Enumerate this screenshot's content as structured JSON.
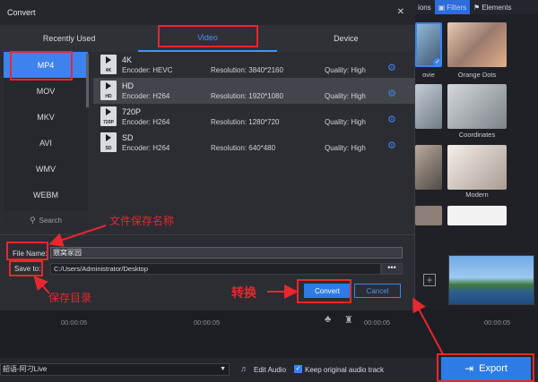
{
  "app": {
    "topbar": {
      "options_label": "ions",
      "filters_label": "Filters",
      "elements_label": "Elements"
    },
    "filters": [
      {
        "label": "ovie"
      },
      {
        "label": "Orange Dots"
      },
      {
        "label": "Coordinates"
      },
      {
        "label": "Modern"
      }
    ],
    "timeline": {
      "time_left": "00:00:05",
      "time_mid": "00:00:05",
      "time_right1": "00:00:05",
      "time_right2": "00:00:05"
    },
    "bottom": {
      "audio_track": "韶语-阿刁Live",
      "edit_audio": "Edit Audio",
      "keep_audio": "Keep original audio track",
      "export_label": "Export"
    }
  },
  "dialog": {
    "title": "Convert",
    "close_glyph": "✕",
    "tabs": [
      {
        "label": "Recently Used"
      },
      {
        "label": "Video"
      },
      {
        "label": "Device"
      }
    ],
    "formats": [
      "MP4",
      "MOV",
      "MKV",
      "AVI",
      "WMV",
      "WEBM"
    ],
    "search_label": "Search",
    "qualities": [
      {
        "icon": "4K",
        "name": "4K",
        "encoder": "Encoder: HEVC",
        "resolution": "Resolution: 3840*2160",
        "quality": "Quality: High"
      },
      {
        "icon": "HD",
        "name": "HD",
        "encoder": "Encoder: H264",
        "resolution": "Resolution: 1920*1080",
        "quality": "Quality: High"
      },
      {
        "icon": "720P",
        "name": "720P",
        "encoder": "Encoder: H264",
        "resolution": "Resolution: 1280*720",
        "quality": "Quality: High"
      },
      {
        "icon": "SD",
        "name": "SD",
        "encoder": "Encoder: H264",
        "resolution": "Resolution: 640*480",
        "quality": "Quality: High"
      }
    ],
    "file_name_label": "File Name:",
    "file_name_value": "猥窝冢园",
    "save_to_label": "Save to:",
    "save_to_value": "C:/Users/Administrator/Desktop",
    "browse_label": "•••",
    "convert_label": "Convert",
    "cancel_label": "Cancel"
  },
  "annotations": {
    "file_name_note": "文件保存名称",
    "save_dir_note": "保存目录",
    "convert_note": "转换"
  },
  "colors": {
    "accent": "#2d7be5",
    "annotation": "#e8272e",
    "selected_row": "#42454c"
  }
}
